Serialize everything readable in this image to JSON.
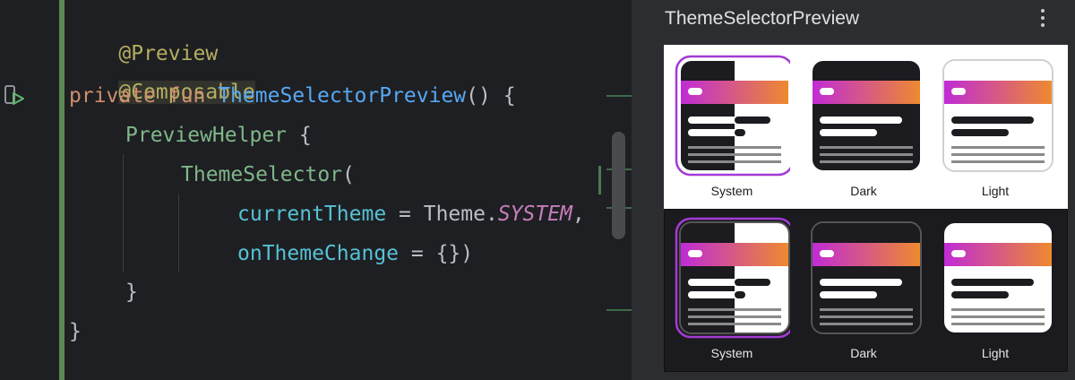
{
  "editor": {
    "lines": {
      "l1": {
        "ann": "@Preview"
      },
      "l2": {
        "ann": "@Composable"
      },
      "l3": {
        "kw1": "private",
        "kw2": "fun",
        "name": "ThemeSelectorPreview",
        "rest": "() {"
      },
      "l4": {
        "call": "PreviewHelper",
        "rest": " {"
      },
      "l5": {
        "call": "ThemeSelector",
        "rest": "("
      },
      "l6": {
        "param": "currentTheme",
        "eq": " = ",
        "obj": "Theme.",
        "const": "SYSTEM",
        "rest": ","
      },
      "l7": {
        "param": "onThemeChange",
        "eq": " = ",
        "rest": "{})"
      },
      "l8": {
        "rest": "}"
      },
      "l9": {
        "rest": "}"
      }
    }
  },
  "preview": {
    "title": "ThemeSelectorPreview",
    "menu_icon": "more-vertical-icon",
    "light_row": {
      "system_label": "System",
      "dark_label": "Dark",
      "light_label": "Light",
      "selected": "System"
    },
    "dark_row": {
      "system_label": "System",
      "dark_label": "Dark",
      "light_label": "Light",
      "selected": "System"
    }
  },
  "colors": {
    "selection_ring": "#a43ad6",
    "header_gradient_start": "#c02bd6",
    "header_gradient_end": "#ee8a2f"
  }
}
